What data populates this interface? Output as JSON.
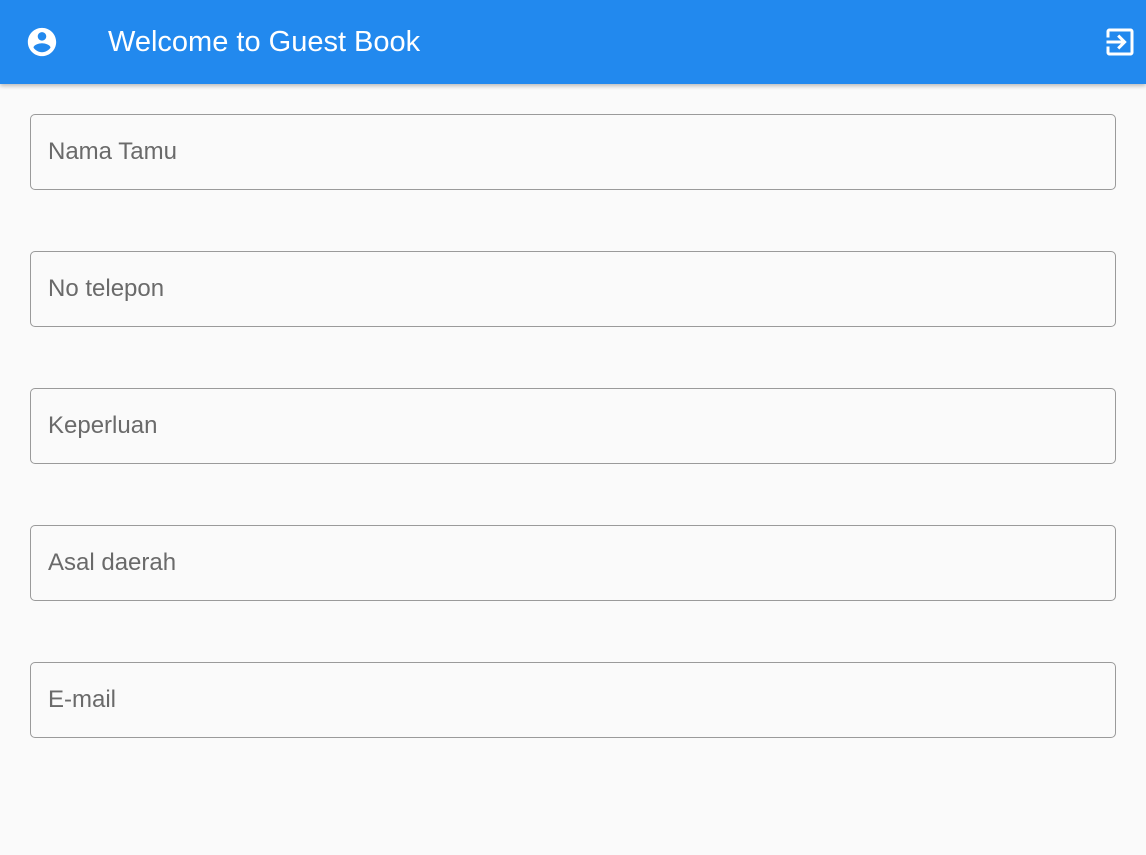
{
  "appbar": {
    "title": "Welcome to Guest Book",
    "background_color": "#2289ee",
    "leading_icon": "account-circle-icon",
    "action_icon": "exit-to-app-icon"
  },
  "form": {
    "fields": [
      {
        "label": "Nama Tamu",
        "value": ""
      },
      {
        "label": "No telepon",
        "value": ""
      },
      {
        "label": "Keperluan",
        "value": ""
      },
      {
        "label": "Asal daerah",
        "value": ""
      },
      {
        "label": "E-mail",
        "value": ""
      }
    ]
  }
}
